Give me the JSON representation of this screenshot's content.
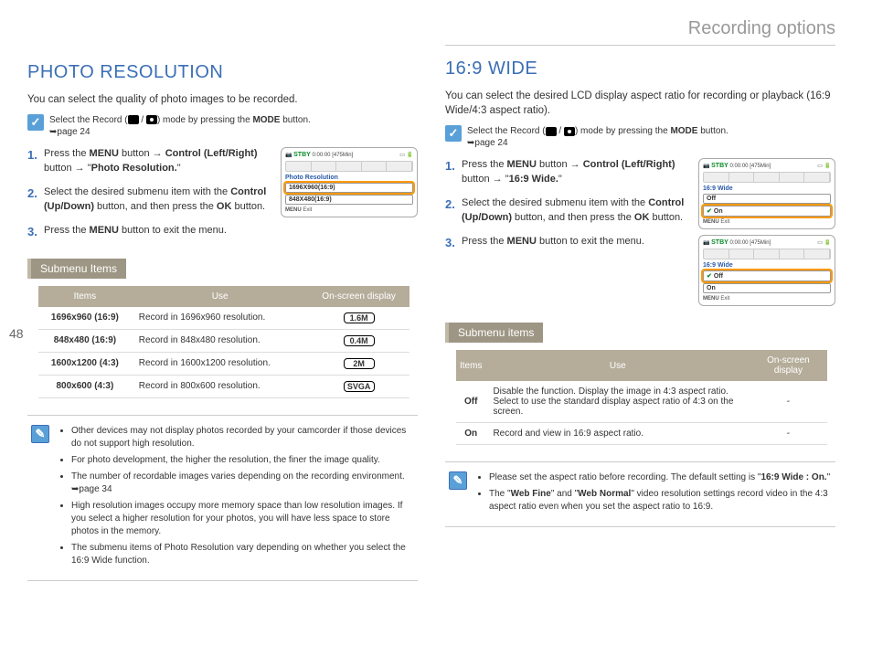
{
  "page_number": "48",
  "header": "Recording options",
  "left": {
    "title": "PHOTO RESOLUTION",
    "lead": "You can select the quality of photo images to be recorded.",
    "mode_note_pre": "Select the Record (",
    "mode_note_mid": " / ",
    "mode_note_post": ") mode by pressing the ",
    "mode_word": "MODE",
    "mode_note_end": " button.",
    "mode_page": "➥page 24",
    "steps": [
      {
        "a": "Press the ",
        "b": "MENU",
        "c": " button → ",
        "d": "Control (Left/Right)",
        "e": " button → \"",
        "f": "Photo Resolution.",
        "g": "\""
      },
      {
        "a": "Select the desired submenu item with the ",
        "b": "Control (Up/Down)",
        "c": " button, and then press the ",
        "d": "OK",
        "e": " button."
      },
      {
        "a": "Press the ",
        "b": "MENU",
        "c": " button to exit the menu."
      }
    ],
    "screenshot": {
      "stby": "STBY",
      "time": "0:00:00",
      "remain": "[475Min]",
      "title": "Photo Resolution",
      "opt_sel": "1696X960(16:9)",
      "opt2": "848X480(16:9)",
      "menu": "MENU",
      "exit": "Exit"
    },
    "submenu_label": "Submenu Items",
    "table_head": {
      "items": "Items",
      "use": "Use",
      "osd": "On-screen display"
    },
    "rows": [
      {
        "i": "1696x960 (16:9)",
        "u": "Record in 1696x960 resolution.",
        "d": "1.6M"
      },
      {
        "i": "848x480 (16:9)",
        "u": "Record in 848x480 resolution.",
        "d": "0.4M"
      },
      {
        "i": "1600x1200 (4:3)",
        "u": "Record in 1600x1200 resolution.",
        "d": "2M"
      },
      {
        "i": "800x600 (4:3)",
        "u": "Record in 800x600 resolution.",
        "d": "SVGA"
      }
    ],
    "notes": [
      "Other devices may not display photos recorded by your camcorder if those devices do not support high resolution.",
      "For photo development, the higher the resolution, the finer the image quality.",
      "The number of recordable images varies depending on the recording environment. ➥page 34",
      "High resolution images occupy more memory space than low resolution images. If you select a higher resolution for your photos, you will have less space to store photos in the memory.",
      "The submenu items of Photo Resolution vary depending on whether you select the 16:9 Wide function."
    ]
  },
  "right": {
    "title": "16:9 WIDE",
    "lead": "You can select the desired LCD display aspect ratio for recording or playback (16:9 Wide/4:3 aspect ratio).",
    "steps": [
      {
        "a": "Press the ",
        "b": "MENU",
        "c": " button → ",
        "d": "Control (Left/Right)",
        "e": " button → \"",
        "f": "16:9 Wide.",
        "g": "\""
      },
      {
        "a": "Select the desired submenu item with the ",
        "b": "Control (Up/Down)",
        "c": " button, and then press the ",
        "d": "OK",
        "e": " button."
      },
      {
        "a": "Press the ",
        "b": "MENU",
        "c": " button to exit the menu."
      }
    ],
    "screenshot1": {
      "stby": "STBY",
      "time": "0:00:00",
      "remain": "[475Min]",
      "title": "16:9 Wide",
      "opt1": "Off",
      "opt_sel": "On",
      "menu": "MENU",
      "exit": "Exit"
    },
    "screenshot2": {
      "stby": "STBY",
      "time": "0:00:00",
      "remain": "[475Min]",
      "title": "16:9 Wide",
      "opt_sel": "Off",
      "opt2": "On",
      "menu": "MENU",
      "exit": "Exit"
    },
    "submenu_label": "Submenu items",
    "table_head": {
      "items": "Items",
      "use": "Use",
      "osd": "On-screen display"
    },
    "rows": [
      {
        "i": "Off",
        "u": "Disable the function. Display the image in 4:3 aspect ratio.\nSelect to use the standard display aspect ratio of 4:3 on the screen.",
        "d": "-"
      },
      {
        "i": "On",
        "u": "Record and view in 16:9 aspect ratio.",
        "d": "-"
      }
    ],
    "notes": [
      {
        "pre": "Please set the aspect ratio before recording. The default setting is \"",
        "b": "16:9 Wide : On.",
        "post": "\""
      },
      {
        "pre": "The \"",
        "b1": "Web Fine",
        "mid": "\" and \"",
        "b2": "Web Normal",
        "post": "\" video resolution settings record video in the 4:3 aspect ratio even when you set the aspect ratio to 16:9."
      }
    ]
  }
}
